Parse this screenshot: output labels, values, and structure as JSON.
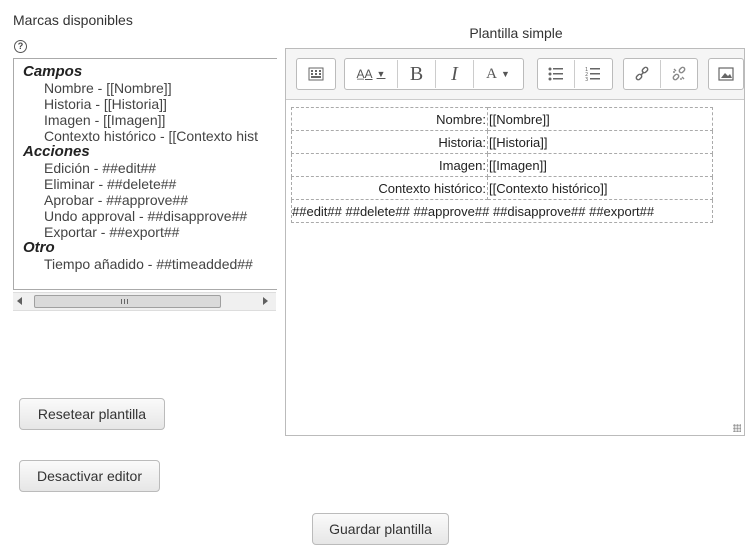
{
  "tags": {
    "title": "Marcas disponibles",
    "help_icon": "?",
    "groups": [
      {
        "name": "Campos",
        "items": [
          "Nombre - [[Nombre]]",
          "Historia - [[Historia]]",
          "Imagen - [[Imagen]]",
          "Contexto histórico - [[Contexto hist"
        ]
      },
      {
        "name": "Acciones",
        "items": [
          "Edición - ##edit##",
          "Eliminar - ##delete##",
          "Aprobar - ##approve##",
          "Undo approval - ##disapprove##",
          "Exportar - ##export##"
        ]
      },
      {
        "name": "Otro",
        "items": [
          "Tiempo añadido - ##timeadded##"
        ]
      }
    ],
    "scroll_grip": "III"
  },
  "buttons": {
    "reset": "Resetear plantilla",
    "disable_editor": "Desactivar editor",
    "save": "Guardar plantilla"
  },
  "template": {
    "title": "Plantilla simple",
    "toolbar": {
      "font_size_icon": "A̲A",
      "bold": "B",
      "italic": "I",
      "font_color_icon": "A"
    },
    "rows": [
      {
        "label": "Nombre:",
        "value": "[[Nombre]]"
      },
      {
        "label": "Historia:",
        "value": "[[Historia]]"
      },
      {
        "label": "Imagen:",
        "value": "[[Imagen]]"
      },
      {
        "label": "Contexto histórico:",
        "value": "[[Contexto histórico]]"
      }
    ],
    "actions_row": "##edit## ##delete## ##approve## ##disapprove## ##export##"
  }
}
